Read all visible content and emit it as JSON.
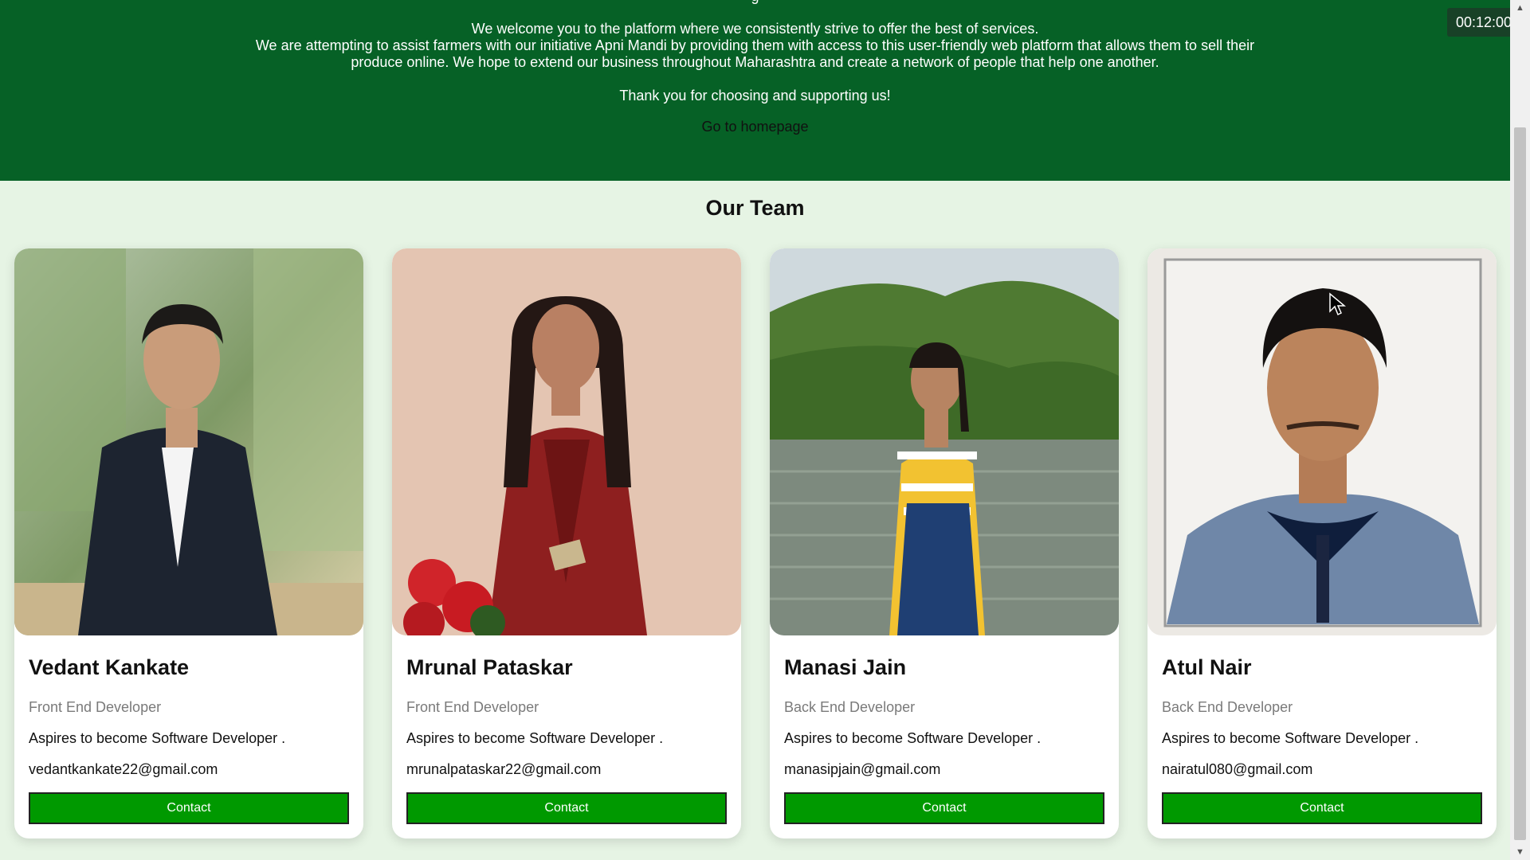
{
  "hero": {
    "clipped_heading": "g",
    "welcome": "We welcome you to the platform where we consistently strive to offer the best of services.",
    "mission": "We are attempting to assist farmers with our initiative Apni Mandi by providing them with access to this user-friendly web platform that allows them to sell their produce online. We hope to extend our business throughout Maharashtra and create a network of people that help one another.",
    "thanks": "Thank you for choosing and supporting us!",
    "home_link": "Go to homepage",
    "background": "#066126"
  },
  "team": {
    "title": "Our Team",
    "members": [
      {
        "name": "Vedant Kankate",
        "role": "Front End Developer",
        "bio": "Aspires to become Software Developer .",
        "email": "vedantkankate22@gmail.com",
        "contact_label": "Contact",
        "photo": "man-in-dark-blazer-portrait"
      },
      {
        "name": "Mrunal Pataskar",
        "role": "Front End Developer",
        "bio": "Aspires to become Software Developer .",
        "email": "mrunalpataskar22@gmail.com",
        "contact_label": "Contact",
        "photo": "woman-in-red-kurta-portrait"
      },
      {
        "name": "Manasi Jain",
        "role": "Back End Developer",
        "bio": "Aspires to become Software Developer .",
        "email": "manasipjain@gmail.com",
        "contact_label": "Contact",
        "photo": "woman-by-lake-portrait"
      },
      {
        "name": "Atul Nair",
        "role": "Back End Developer",
        "bio": "Aspires to become Software Developer .",
        "email": "nairatul080@gmail.com",
        "contact_label": "Contact",
        "photo": "man-passport-photo-portrait"
      }
    ]
  },
  "overlay": {
    "timer": "00:12:00"
  },
  "colors": {
    "page_bg": "#e6f4e4",
    "contact_button": "#009900",
    "hero_bg": "#066126"
  }
}
